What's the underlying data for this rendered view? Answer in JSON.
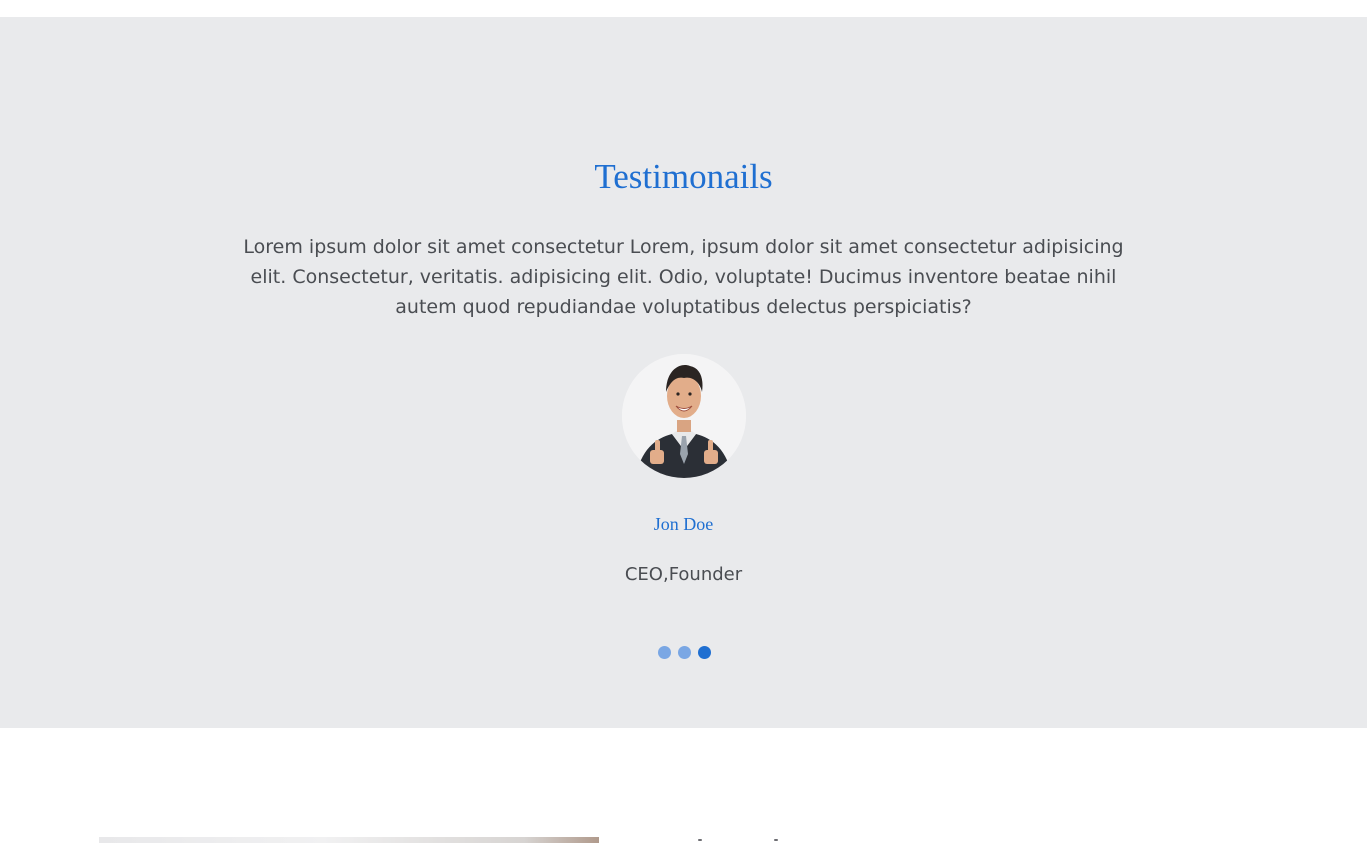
{
  "testimonials": {
    "title": "Testimonails",
    "quote": "Lorem ipsum dolor sit amet consectetur Lorem, ipsum dolor sit amet consectetur adipisicing elit. Consectetur, veritatis. adipisicing elit. Odio, voluptate! Ducimus inventore beatae nihil autem quod repudiandae voluptatibus delectus perspiciatis?",
    "person": {
      "name": "Jon Doe",
      "role": "CEO,Founder",
      "avatar_icon": "person-thumbs-up-photo"
    },
    "carousel": {
      "total": 3,
      "active_index": 3
    }
  },
  "colors": {
    "section_bg": "#e9eaec",
    "accent": "#1f6fd1",
    "text": "#4a4d52",
    "dot_inactive": "#7aa7e4"
  }
}
